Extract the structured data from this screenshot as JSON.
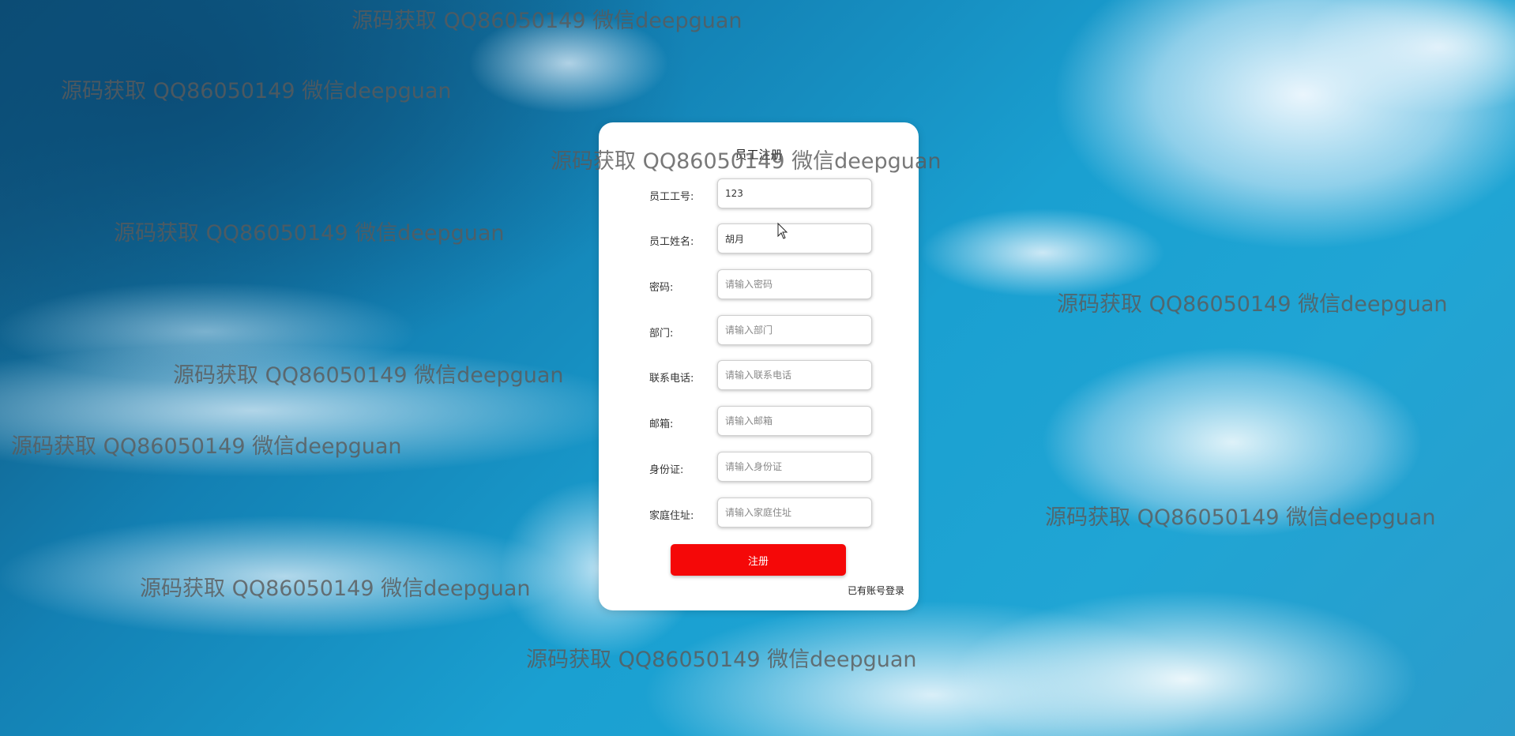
{
  "form": {
    "title": "员工注册",
    "fields": [
      {
        "label": "员工工号:",
        "value": "123",
        "placeholder": ""
      },
      {
        "label": "员工姓名:",
        "value": "胡月",
        "placeholder": ""
      },
      {
        "label": "密码:",
        "value": "",
        "placeholder": "请输入密码"
      },
      {
        "label": "部门:",
        "value": "",
        "placeholder": "请输入部门"
      },
      {
        "label": "联系电话:",
        "value": "",
        "placeholder": "请输入联系电话"
      },
      {
        "label": "邮箱:",
        "value": "",
        "placeholder": "请输入邮箱"
      },
      {
        "label": "身份证:",
        "value": "",
        "placeholder": "请输入身份证"
      },
      {
        "label": "家庭住址:",
        "value": "",
        "placeholder": "请输入家庭住址"
      }
    ],
    "submit_label": "注册",
    "login_link": "已有账号登录"
  },
  "watermark_text": "源码获取 QQ86050149 微信deepguan",
  "colors": {
    "submit_button": "#f50808",
    "card_background": "#ffffff"
  }
}
